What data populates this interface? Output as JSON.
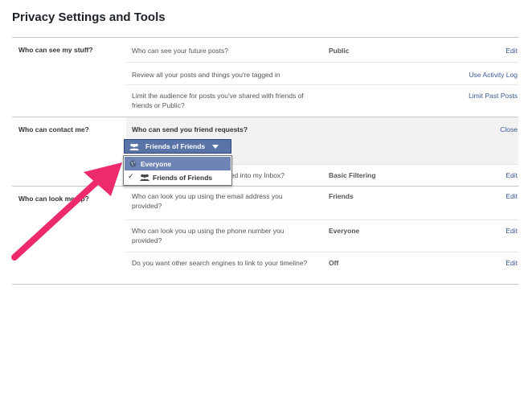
{
  "page": {
    "title": "Privacy Settings and Tools"
  },
  "sections": {
    "stuff": {
      "label": "Who can see my stuff?",
      "rows": [
        {
          "question": "Who can see your future posts?",
          "value": "Public",
          "action": "Edit"
        },
        {
          "question": "Review all your posts and things you're tagged in",
          "value": "",
          "action": "Use Activity Log"
        },
        {
          "question": "Limit the audience for posts you've shared with friends of friends or Public?",
          "value": "",
          "action": "Limit Past Posts"
        }
      ]
    },
    "contact": {
      "label": "Who can contact me?",
      "rows": [
        {
          "question": "Who can send you friend requests?",
          "value": "",
          "action": "Close"
        },
        {
          "question": "Whose messages do I want filtered into my Inbox?",
          "value": "Basic Filtering",
          "action": "Edit"
        }
      ]
    },
    "lookup": {
      "label": "Who can look me up?",
      "rows": [
        {
          "question": "Who can look you up using the email address you provided?",
          "value": "Friends",
          "action": "Edit"
        },
        {
          "question": "Who can look you up using the phone number you provided?",
          "value": "Everyone",
          "action": "Edit"
        },
        {
          "question": "Do you want other search engines to link to your timeline?",
          "value": "Off",
          "action": "Edit"
        }
      ]
    }
  },
  "audience_selector": {
    "selected": "Friends of Friends",
    "options": [
      "Everyone",
      "Friends of Friends"
    ]
  },
  "colors": {
    "link": "#3b5998",
    "button": "#5b74a8",
    "highlight": "#6d84b4",
    "arrow": "#ee2a6e"
  }
}
